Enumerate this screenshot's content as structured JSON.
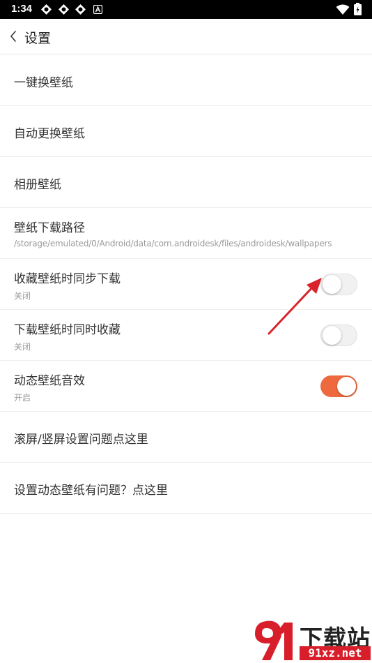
{
  "status_bar": {
    "time": "1:34",
    "icons": [
      "app-notification-icon",
      "app-notification-icon",
      "app-notification-icon",
      "a-letter-icon",
      "wifi-icon",
      "battery-icon"
    ]
  },
  "header": {
    "title": "设置"
  },
  "settings": {
    "items": [
      {
        "title": "一键换壁纸"
      },
      {
        "title": "自动更换壁纸"
      },
      {
        "title": "相册壁纸"
      },
      {
        "title": "壁纸下载路径",
        "subtitle": "/storage/emulated/0/Android/data/com.androidesk/files/androidesk/wallpapers"
      },
      {
        "title": "收藏壁纸时同步下载",
        "subtitle": "关闭",
        "toggle": false
      },
      {
        "title": "下载壁纸时同时收藏",
        "subtitle": "关闭",
        "toggle": false
      },
      {
        "title": "动态壁纸音效",
        "subtitle": "开启",
        "toggle": true
      },
      {
        "title": "滚屏/竖屏设置问题点这里"
      },
      {
        "title": "设置动态壁纸有问题？点这里"
      }
    ]
  },
  "watermark": {
    "logo_text": "91",
    "name": "下载站",
    "url": "91xz.net"
  },
  "colors": {
    "accent": "#ee6a3e",
    "annotation_arrow": "#d8232a",
    "watermark_red": "#d81e2a"
  }
}
